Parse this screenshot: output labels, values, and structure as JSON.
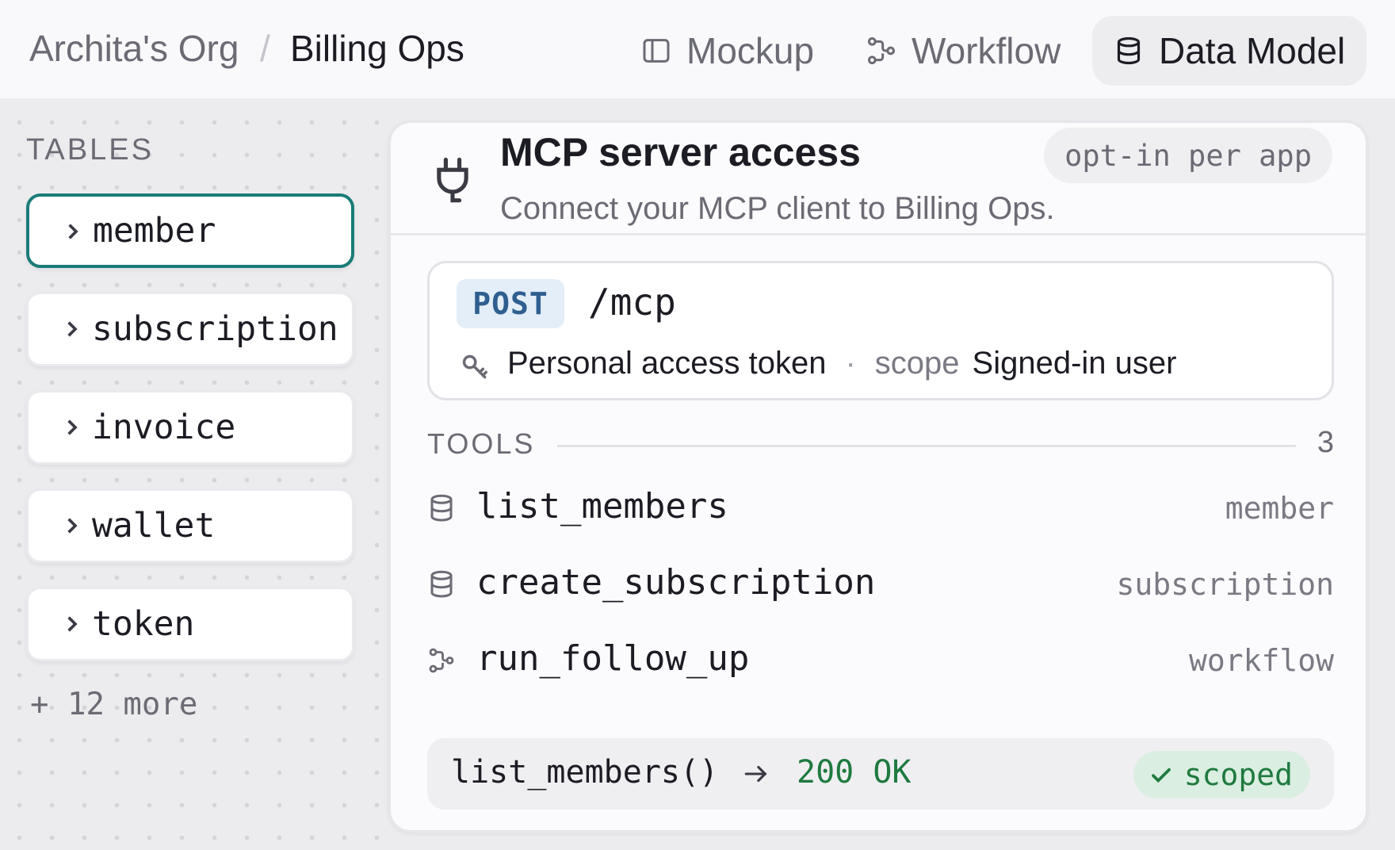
{
  "breadcrumb": {
    "org": "Archita's Org",
    "separator": "/",
    "app": "Billing Ops"
  },
  "nav": {
    "tabs": [
      {
        "label": "Mockup",
        "icon": "panel-icon"
      },
      {
        "label": "Workflow",
        "icon": "workflow-icon"
      },
      {
        "label": "Data Model",
        "icon": "database-icon",
        "active": true
      }
    ]
  },
  "sidebar": {
    "title": "TABLES",
    "items": [
      {
        "label": "member",
        "selected": true
      },
      {
        "label": "subscription"
      },
      {
        "label": "invoice"
      },
      {
        "label": "wallet"
      },
      {
        "label": "token"
      }
    ],
    "more": "+ 12 more"
  },
  "card": {
    "title": "MCP server access",
    "subtitle": "Connect your MCP client to Billing Ops.",
    "badge": "opt-in per app",
    "endpoint": {
      "method": "POST",
      "path": "/mcp",
      "auth": "Personal access token",
      "separator": "·",
      "scope_label": "scope",
      "scope": "Signed-in user"
    },
    "tools": {
      "title": "TOOLS",
      "count": "3",
      "items": [
        {
          "name": "list_members",
          "tag": "member",
          "icon": "database-icon"
        },
        {
          "name": "create_subscription",
          "tag": "subscription",
          "icon": "database-icon"
        },
        {
          "name": "run_follow_up",
          "tag": "workflow",
          "icon": "workflow-icon"
        }
      ]
    },
    "result": {
      "call": "list_members()",
      "status": "200 OK",
      "badge": "scoped"
    }
  },
  "colors": {
    "accent_teal": "#1a7c78",
    "success_green": "#1f7a3f",
    "method_blue": "#2f5f90"
  }
}
